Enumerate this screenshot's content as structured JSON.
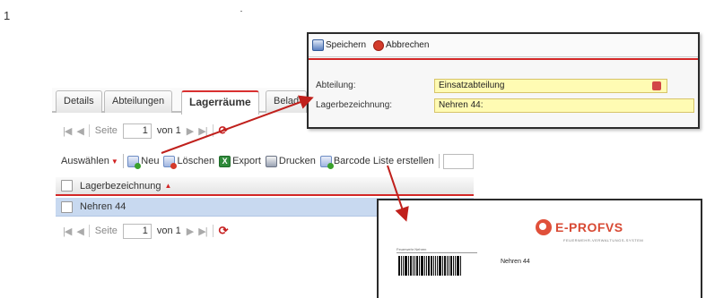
{
  "step_number": "1",
  "main_panel": {
    "tabs": [
      {
        "label": "Details",
        "active": false
      },
      {
        "label": "Abteilungen",
        "active": false
      },
      {
        "label": "Lagerräume",
        "active": true
      },
      {
        "label": "Belad",
        "active": false
      }
    ],
    "pager_top": {
      "page_label": "Seite",
      "page_value": "1",
      "of_label": "von 1"
    },
    "toolbar": {
      "select_label": "Auswählen",
      "new_label": "Neu",
      "delete_label": "Löschen",
      "export_label": "Export",
      "print_label": "Drucken",
      "barcode_label": "Barcode Liste erstellen"
    },
    "grid": {
      "column_header": "Lagerbezeichnung",
      "rows": [
        {
          "lagerbezeichnung": "Nehren 44",
          "selected": true
        }
      ]
    },
    "pager_bottom": {
      "page_label": "Seite",
      "page_value": "1",
      "of_label": "von 1"
    }
  },
  "popup": {
    "save_label": "Speichern",
    "cancel_label": "Abbrechen",
    "fields": [
      {
        "label": "Abteilung:",
        "value": "Einsatzabteilung",
        "type": "select"
      },
      {
        "label": "Lagerbezeichnung:",
        "value": "Nehren 44:",
        "type": "text"
      }
    ]
  },
  "label_preview": {
    "logo_text": "E-PROFVS",
    "logo_subtitle": "FEUERWEHR-VERWALTUNGS-SYSTEM",
    "small_text": "Feuerwehr Nehren",
    "item_name": "Nehren 44"
  },
  "colors": {
    "accent_red": "#d32727",
    "selection_blue": "#c8d9f0",
    "field_yellow": "#fffbb3",
    "logo_red": "#d84a34"
  }
}
